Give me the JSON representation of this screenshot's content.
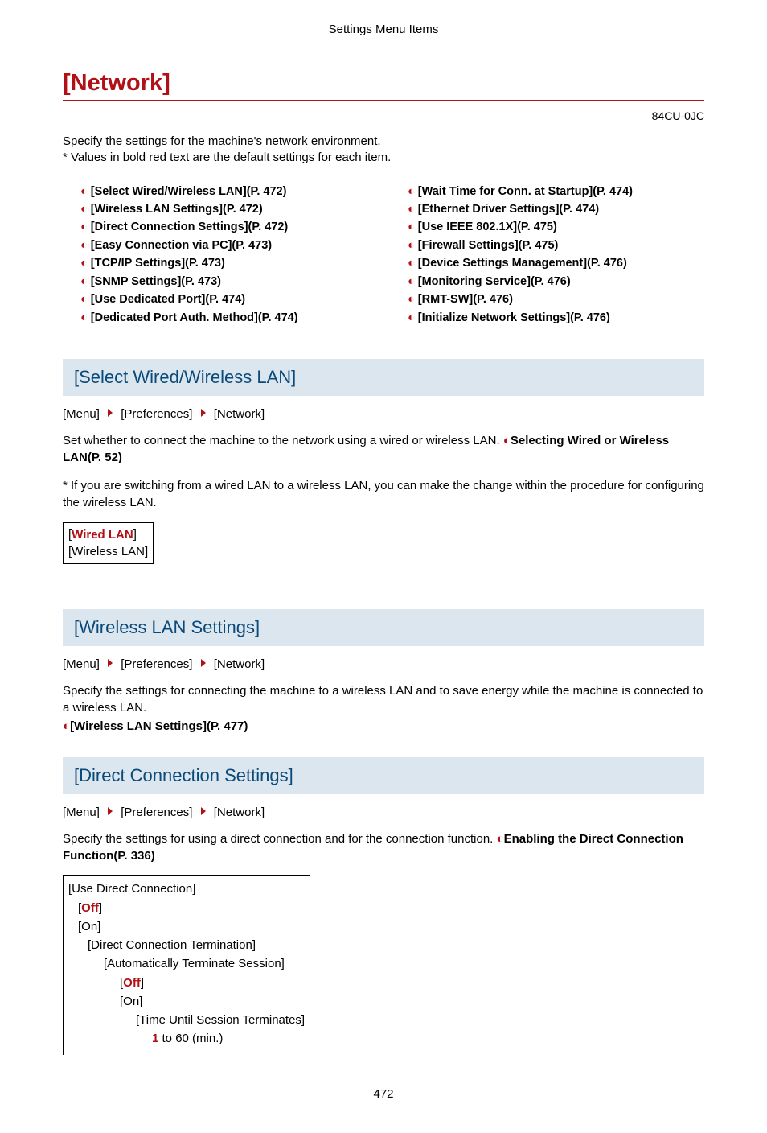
{
  "header": "Settings Menu Items",
  "title": "[Network]",
  "doc_code": "84CU-0JC",
  "intro_line1": "Specify the settings for the machine's network environment.",
  "intro_line2": "* Values in bold red text are the default settings for each item.",
  "toc": {
    "left": [
      "[Select Wired/Wireless LAN](P. 472)",
      "[Wireless LAN Settings](P. 472)",
      "[Direct Connection Settings](P. 472)",
      "[Easy Connection via PC](P. 473)",
      "[TCP/IP Settings](P. 473)",
      "[SNMP Settings](P. 473)",
      "[Use Dedicated Port](P. 474)",
      "[Dedicated Port Auth. Method](P. 474)"
    ],
    "right": [
      "[Wait Time for Conn. at Startup](P. 474)",
      "[Ethernet Driver Settings](P. 474)",
      "[Use IEEE 802.1X](P. 475)",
      "[Firewall Settings](P. 475)",
      "[Device Settings Management](P. 476)",
      "[Monitoring Service](P. 476)",
      "[RMT-SW](P. 476)",
      "[Initialize Network Settings](P. 476)"
    ]
  },
  "crumb": {
    "a": "[Menu]",
    "b": "[Preferences]",
    "c": "[Network]"
  },
  "s1": {
    "title": "[Select Wired/Wireless LAN]",
    "body1": "Set whether to connect the machine to the network using a wired or wireless LAN. ",
    "link": "Selecting Wired or Wireless LAN(P. 52)",
    "body2": "* If you are switching from a wired LAN to a wireless LAN, you can make the change within the procedure for configuring the wireless LAN.",
    "opt_default": "Wired LAN",
    "opt_other": "[Wireless LAN]"
  },
  "s2": {
    "title": "[Wireless LAN Settings]",
    "body": "Specify the settings for connecting the machine to a wireless LAN and to save energy while the machine is connected to a wireless LAN.",
    "link": "[Wireless LAN Settings](P. 477)"
  },
  "s3": {
    "title": "[Direct Connection Settings]",
    "body": "Specify the settings for using a direct connection and for the connection function. ",
    "link": "Enabling the Direct Connection Function(P. 336)",
    "opts": {
      "l1": "[Use Direct Connection]",
      "l2_off": "Off",
      "l3_on": "[On]",
      "l4": "[Direct Connection Termination]",
      "l5": "[Automatically Terminate Session]",
      "l6_off": "Off",
      "l7_on": "[On]",
      "l8": "[Time Until Session Terminates]",
      "l9_a": "1",
      "l9_b": " to 60 (min.)"
    }
  },
  "page_number": "472"
}
